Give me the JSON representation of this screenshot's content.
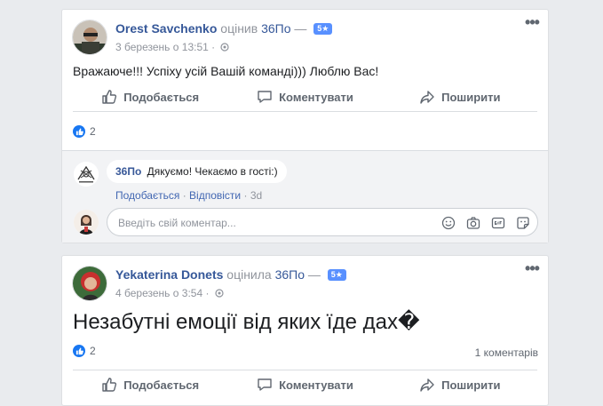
{
  "posts": [
    {
      "author": "Orest Savchenko",
      "verb": "оцінив",
      "page": "36По",
      "dash": "—",
      "rating": "5★",
      "date": "3 березень о 13:51",
      "dot": "·",
      "text": "Вражаюче!!! Успіху усій Вашій команді))) Люблю Вас!",
      "actions": {
        "like": "Подобається",
        "comment": "Коментувати",
        "share": "Поширити"
      },
      "reaction_count": "2",
      "reply": {
        "author": "36По",
        "text": "Дякуємо! Чекаємо в гості:)",
        "like": "Подобається",
        "sep1": "·",
        "replies": "Відповісти",
        "sep2": "·",
        "time": "3d"
      },
      "comment_placeholder": "Введіть свій коментар...",
      "comment_icons": [
        "emoji-icon",
        "camera-icon",
        "gif-icon",
        "sticker-icon"
      ]
    },
    {
      "author": "Yekaterina Donets",
      "verb": "оцінила",
      "page": "36По",
      "dash": "—",
      "rating": "5★",
      "date": "4 березень о 3:54",
      "dot": "·",
      "text": "Незабутні емоції від яких їде дах�",
      "reaction_count": "2",
      "comments_count": "1 коментарів",
      "actions": {
        "like": "Подобається",
        "comment": "Коментувати",
        "share": "Поширити"
      }
    }
  ],
  "colors": {
    "link": "#365899",
    "like_blue": "#1877f2",
    "rating_badge": "#5890ff",
    "background": "#e9ebee"
  }
}
